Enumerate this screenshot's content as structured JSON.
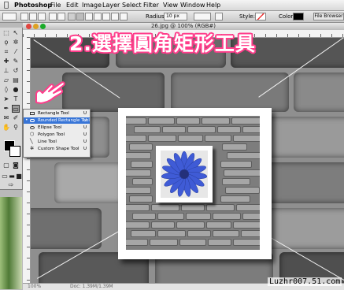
{
  "menubar": {
    "app_name": "Photoshop",
    "items": [
      "File",
      "Edit",
      "Image",
      "Layer",
      "Select",
      "Filter",
      "View",
      "Window",
      "Help"
    ]
  },
  "options_bar": {
    "radius_label": "Radius:",
    "radius_value": "10 px",
    "style_label": "Style:",
    "color_label": "Color:",
    "file_browser_label": "File Browser"
  },
  "document": {
    "title": "26.jpg @ 100% (RGB#)",
    "zoom": "100%",
    "doc_info": "Doc: 1.39M/1.39M"
  },
  "shape_flyout": {
    "items": [
      {
        "label": "Rectangle Tool",
        "shortcut": "U",
        "selected": false
      },
      {
        "label": "Rounded Rectangle Tool",
        "shortcut": "U",
        "selected": true
      },
      {
        "label": "Ellipse Tool",
        "shortcut": "U",
        "selected": false
      },
      {
        "label": "Polygon Tool",
        "shortcut": "U",
        "selected": false
      },
      {
        "label": "Line Tool",
        "shortcut": "U",
        "selected": false
      },
      {
        "label": "Custom Shape Tool",
        "shortcut": "U",
        "selected": false
      }
    ]
  },
  "annotation": {
    "caption": "2.選擇圓角矩形工具",
    "pointer_icon": "hand-pointer-icon"
  },
  "watermark": "Luzhr007.51.com",
  "colors": {
    "caption_outline": "#ff3d8b",
    "selection_highlight": "#3875d7",
    "flower": "#3f5bd6"
  }
}
